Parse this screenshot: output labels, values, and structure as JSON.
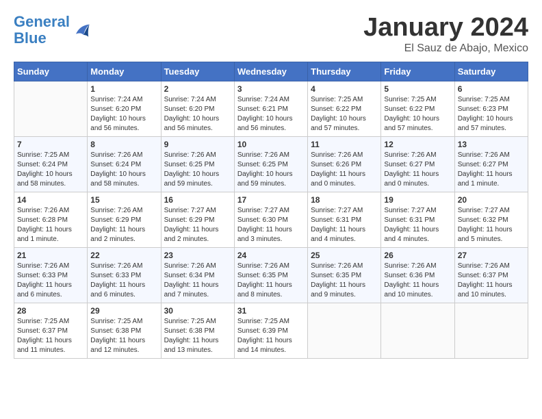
{
  "logo": {
    "line1": "General",
    "line2": "Blue"
  },
  "title": "January 2024",
  "subtitle": "El Sauz de Abajo, Mexico",
  "days_header": [
    "Sunday",
    "Monday",
    "Tuesday",
    "Wednesday",
    "Thursday",
    "Friday",
    "Saturday"
  ],
  "weeks": [
    [
      {
        "num": "",
        "info": ""
      },
      {
        "num": "1",
        "info": "Sunrise: 7:24 AM\nSunset: 6:20 PM\nDaylight: 10 hours\nand 56 minutes."
      },
      {
        "num": "2",
        "info": "Sunrise: 7:24 AM\nSunset: 6:20 PM\nDaylight: 10 hours\nand 56 minutes."
      },
      {
        "num": "3",
        "info": "Sunrise: 7:24 AM\nSunset: 6:21 PM\nDaylight: 10 hours\nand 56 minutes."
      },
      {
        "num": "4",
        "info": "Sunrise: 7:25 AM\nSunset: 6:22 PM\nDaylight: 10 hours\nand 57 minutes."
      },
      {
        "num": "5",
        "info": "Sunrise: 7:25 AM\nSunset: 6:22 PM\nDaylight: 10 hours\nand 57 minutes."
      },
      {
        "num": "6",
        "info": "Sunrise: 7:25 AM\nSunset: 6:23 PM\nDaylight: 10 hours\nand 57 minutes."
      }
    ],
    [
      {
        "num": "7",
        "info": "Sunrise: 7:25 AM\nSunset: 6:24 PM\nDaylight: 10 hours\nand 58 minutes."
      },
      {
        "num": "8",
        "info": "Sunrise: 7:26 AM\nSunset: 6:24 PM\nDaylight: 10 hours\nand 58 minutes."
      },
      {
        "num": "9",
        "info": "Sunrise: 7:26 AM\nSunset: 6:25 PM\nDaylight: 10 hours\nand 59 minutes."
      },
      {
        "num": "10",
        "info": "Sunrise: 7:26 AM\nSunset: 6:25 PM\nDaylight: 10 hours\nand 59 minutes."
      },
      {
        "num": "11",
        "info": "Sunrise: 7:26 AM\nSunset: 6:26 PM\nDaylight: 11 hours\nand 0 minutes."
      },
      {
        "num": "12",
        "info": "Sunrise: 7:26 AM\nSunset: 6:27 PM\nDaylight: 11 hours\nand 0 minutes."
      },
      {
        "num": "13",
        "info": "Sunrise: 7:26 AM\nSunset: 6:27 PM\nDaylight: 11 hours\nand 1 minute."
      }
    ],
    [
      {
        "num": "14",
        "info": "Sunrise: 7:26 AM\nSunset: 6:28 PM\nDaylight: 11 hours\nand 1 minute."
      },
      {
        "num": "15",
        "info": "Sunrise: 7:26 AM\nSunset: 6:29 PM\nDaylight: 11 hours\nand 2 minutes."
      },
      {
        "num": "16",
        "info": "Sunrise: 7:27 AM\nSunset: 6:29 PM\nDaylight: 11 hours\nand 2 minutes."
      },
      {
        "num": "17",
        "info": "Sunrise: 7:27 AM\nSunset: 6:30 PM\nDaylight: 11 hours\nand 3 minutes."
      },
      {
        "num": "18",
        "info": "Sunrise: 7:27 AM\nSunset: 6:31 PM\nDaylight: 11 hours\nand 4 minutes."
      },
      {
        "num": "19",
        "info": "Sunrise: 7:27 AM\nSunset: 6:31 PM\nDaylight: 11 hours\nand 4 minutes."
      },
      {
        "num": "20",
        "info": "Sunrise: 7:27 AM\nSunset: 6:32 PM\nDaylight: 11 hours\nand 5 minutes."
      }
    ],
    [
      {
        "num": "21",
        "info": "Sunrise: 7:26 AM\nSunset: 6:33 PM\nDaylight: 11 hours\nand 6 minutes."
      },
      {
        "num": "22",
        "info": "Sunrise: 7:26 AM\nSunset: 6:33 PM\nDaylight: 11 hours\nand 6 minutes."
      },
      {
        "num": "23",
        "info": "Sunrise: 7:26 AM\nSunset: 6:34 PM\nDaylight: 11 hours\nand 7 minutes."
      },
      {
        "num": "24",
        "info": "Sunrise: 7:26 AM\nSunset: 6:35 PM\nDaylight: 11 hours\nand 8 minutes."
      },
      {
        "num": "25",
        "info": "Sunrise: 7:26 AM\nSunset: 6:35 PM\nDaylight: 11 hours\nand 9 minutes."
      },
      {
        "num": "26",
        "info": "Sunrise: 7:26 AM\nSunset: 6:36 PM\nDaylight: 11 hours\nand 10 minutes."
      },
      {
        "num": "27",
        "info": "Sunrise: 7:26 AM\nSunset: 6:37 PM\nDaylight: 11 hours\nand 10 minutes."
      }
    ],
    [
      {
        "num": "28",
        "info": "Sunrise: 7:25 AM\nSunset: 6:37 PM\nDaylight: 11 hours\nand 11 minutes."
      },
      {
        "num": "29",
        "info": "Sunrise: 7:25 AM\nSunset: 6:38 PM\nDaylight: 11 hours\nand 12 minutes."
      },
      {
        "num": "30",
        "info": "Sunrise: 7:25 AM\nSunset: 6:38 PM\nDaylight: 11 hours\nand 13 minutes."
      },
      {
        "num": "31",
        "info": "Sunrise: 7:25 AM\nSunset: 6:39 PM\nDaylight: 11 hours\nand 14 minutes."
      },
      {
        "num": "",
        "info": ""
      },
      {
        "num": "",
        "info": ""
      },
      {
        "num": "",
        "info": ""
      }
    ]
  ]
}
